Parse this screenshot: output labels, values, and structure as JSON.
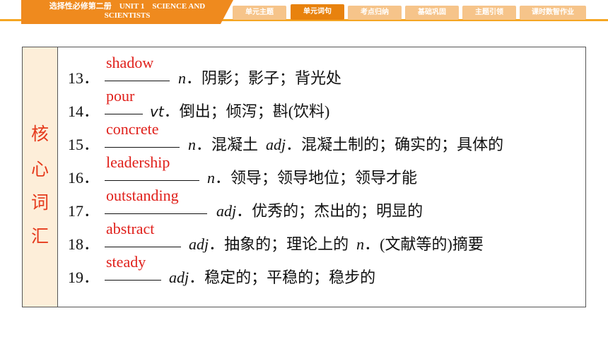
{
  "header": {
    "course_title_line1": "选择性必修第二册　UNIT 1　SCIENCE AND",
    "course_title_line2": "SCIENTISTS",
    "tabs": [
      {
        "label": "单元主题",
        "active": false
      },
      {
        "label": "单元词句",
        "active": true
      },
      {
        "label": "考点归纳",
        "active": false
      },
      {
        "label": "基础巩固",
        "active": false
      },
      {
        "label": "主题引领",
        "active": false
      },
      {
        "label": "课时数智作业",
        "active": false
      }
    ]
  },
  "side_label": [
    "核",
    "心",
    "词",
    "汇"
  ],
  "vocab": [
    {
      "num": "13．",
      "answer": "shadow",
      "pos": "n",
      "meaning": "阴影；影子；背光处"
    },
    {
      "num": "14．",
      "answer": "pour",
      "pos": "vt",
      "meaning": "倒出；倾泻；斟(饮料)"
    },
    {
      "num": "15．",
      "answer": "concrete",
      "pos": "n",
      "meaning": "混凝土",
      "pos2": "adj",
      "meaning2": "混凝土制的；确实的；具体的"
    },
    {
      "num": "16．",
      "answer": "leadership",
      "pos": "n",
      "meaning": "领导；领导地位；领导才能"
    },
    {
      "num": "17．",
      "answer": "outstanding",
      "pos": "adj",
      "meaning": "优秀的；杰出的；明显的"
    },
    {
      "num": "18．",
      "answer": "abstract",
      "pos": "adj",
      "meaning": "抽象的；理论上的",
      "pos2": "n",
      "meaning2": "(文献等的)摘要"
    },
    {
      "num": "19．",
      "answer": "steady",
      "pos": "adj",
      "meaning": "稳定的；平稳的；稳步的"
    }
  ],
  "colors": {
    "accent_orange": "#ef8a1e",
    "answer_red": "#e0201b",
    "side_bg": "#fdeed9"
  }
}
